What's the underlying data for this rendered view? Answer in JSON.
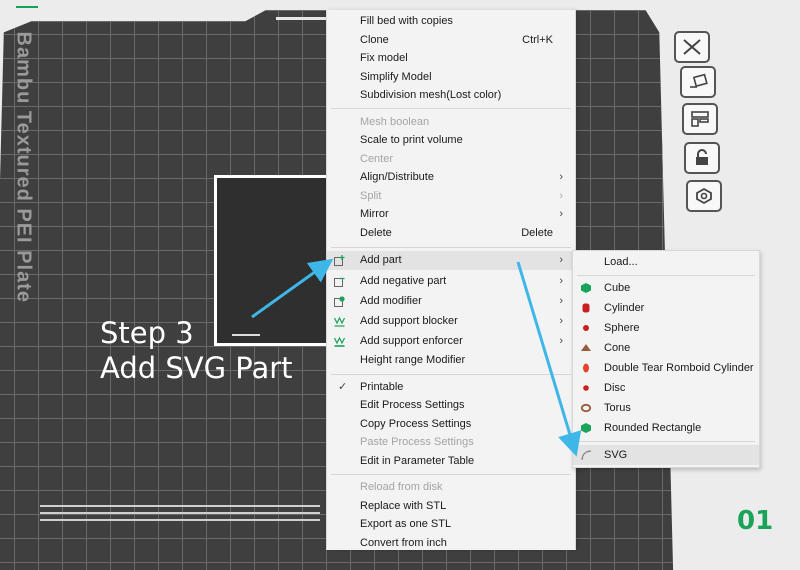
{
  "bed": {
    "label": "Bambu Textured PEI Plate",
    "plate_number": "01"
  },
  "annotation": {
    "line1": "Step 3",
    "line2": "Add SVG Part"
  },
  "context_menu": {
    "items": [
      {
        "label": "Fill bed with copies"
      },
      {
        "label": "Clone",
        "shortcut": "Ctrl+K"
      },
      {
        "label": "Fix model"
      },
      {
        "label": "Simplify Model"
      },
      {
        "label": "Subdivision mesh(Lost color)"
      },
      {
        "label": "Mesh boolean"
      },
      {
        "label": "Scale to print volume"
      },
      {
        "label": "Center"
      },
      {
        "label": "Align/Distribute"
      },
      {
        "label": "Split"
      },
      {
        "label": "Mirror"
      },
      {
        "label": "Delete",
        "shortcut": "Delete"
      },
      {
        "label": "Add part"
      },
      {
        "label": "Add negative part"
      },
      {
        "label": "Add modifier"
      },
      {
        "label": "Add support blocker"
      },
      {
        "label": "Add support enforcer"
      },
      {
        "label": "Height range Modifier"
      },
      {
        "label": "Printable"
      },
      {
        "label": "Edit Process Settings"
      },
      {
        "label": "Copy Process Settings"
      },
      {
        "label": "Paste Process Settings"
      },
      {
        "label": "Edit in Parameter Table"
      },
      {
        "label": "Reload from disk"
      },
      {
        "label": "Replace with STL"
      },
      {
        "label": "Export as one STL"
      },
      {
        "label": "Convert from inch"
      }
    ]
  },
  "add_part_submenu": {
    "items": [
      {
        "label": "Load..."
      },
      {
        "label": "Cube"
      },
      {
        "label": "Cylinder"
      },
      {
        "label": "Sphere"
      },
      {
        "label": "Cone"
      },
      {
        "label": "Double Tear Romboid Cylinder"
      },
      {
        "label": "Disc"
      },
      {
        "label": "Torus"
      },
      {
        "label": "Rounded Rectangle"
      },
      {
        "label": "SVG"
      }
    ]
  },
  "colors": {
    "accent_green": "#1aa35a",
    "arrow_blue": "#3fb6e8",
    "bed_dark": "#3f3f3f"
  }
}
